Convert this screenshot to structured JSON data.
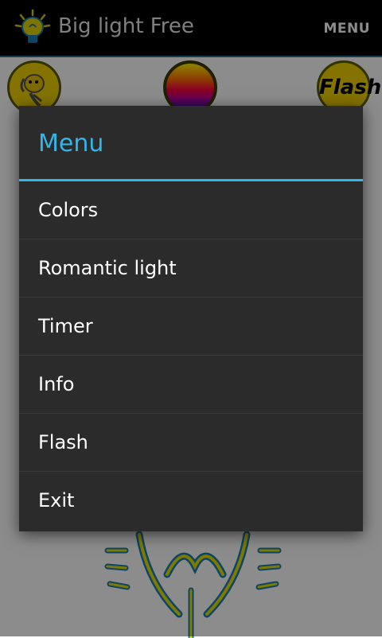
{
  "action_bar": {
    "title": "Big light Free",
    "menu_label": "MENU",
    "background": "#000000",
    "title_color": "#e8e8e8"
  },
  "toolbar_icons": {
    "dog": "dog-icon",
    "colors": "color-palette-icon",
    "flash_label": "Flash"
  },
  "dialog": {
    "title": "Menu",
    "accent": "#33b5e5",
    "items": [
      {
        "label": "Colors"
      },
      {
        "label": "Romantic light"
      },
      {
        "label": "Timer"
      },
      {
        "label": "Info"
      },
      {
        "label": "Flash"
      },
      {
        "label": "Exit"
      }
    ]
  }
}
